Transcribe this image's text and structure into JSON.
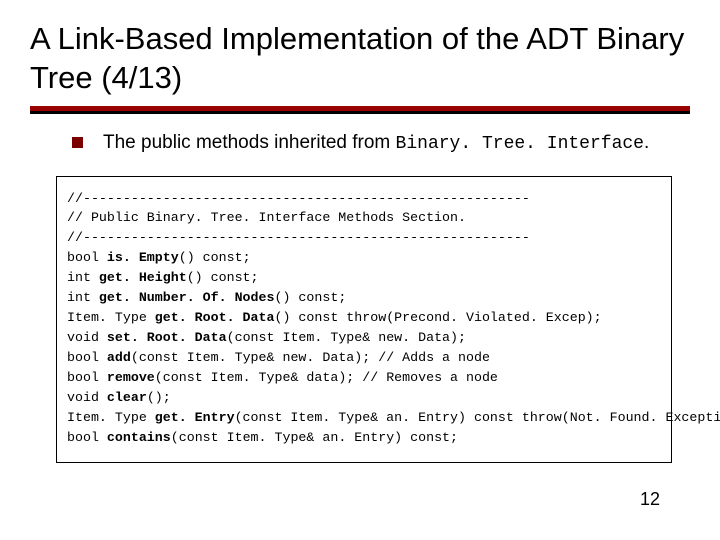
{
  "title": "A Link-Based Implementation of the ADT Binary Tree (4/13)",
  "bullet": {
    "text_pre": "The public methods inherited from ",
    "text_code": "Binary. Tree. Interface",
    "text_post": "."
  },
  "code": {
    "lines": [
      {
        "pre": "//--------------------------------------------------------",
        "bold": "",
        "post": ""
      },
      {
        "pre": "// Public Binary. Tree. Interface Methods Section.",
        "bold": "",
        "post": ""
      },
      {
        "pre": "//--------------------------------------------------------",
        "bold": "",
        "post": ""
      },
      {
        "pre": "bool ",
        "bold": "is. Empty",
        "post": "() const;"
      },
      {
        "pre": "int ",
        "bold": "get. Height",
        "post": "() const;"
      },
      {
        "pre": "int ",
        "bold": "get. Number. Of. Nodes",
        "post": "() const;"
      },
      {
        "pre": "Item. Type ",
        "bold": "get. Root. Data",
        "post": "() const throw(Precond. Violated. Excep);"
      },
      {
        "pre": "void ",
        "bold": "set. Root. Data",
        "post": "(const Item. Type& new. Data);"
      },
      {
        "pre": "bool ",
        "bold": "add",
        "post": "(const Item. Type& new. Data); // Adds a node"
      },
      {
        "pre": "bool ",
        "bold": "remove",
        "post": "(const Item. Type& data); // Removes a node"
      },
      {
        "pre": "void ",
        "bold": "clear",
        "post": "();"
      },
      {
        "pre": "Item. Type ",
        "bold": "get. Entry",
        "post": "(const Item. Type& an. Entry) const throw(Not. Found. Exception);"
      },
      {
        "pre": "bool ",
        "bold": "contains",
        "post": "(const Item. Type& an. Entry) const;"
      }
    ]
  },
  "slideNumber": "12"
}
